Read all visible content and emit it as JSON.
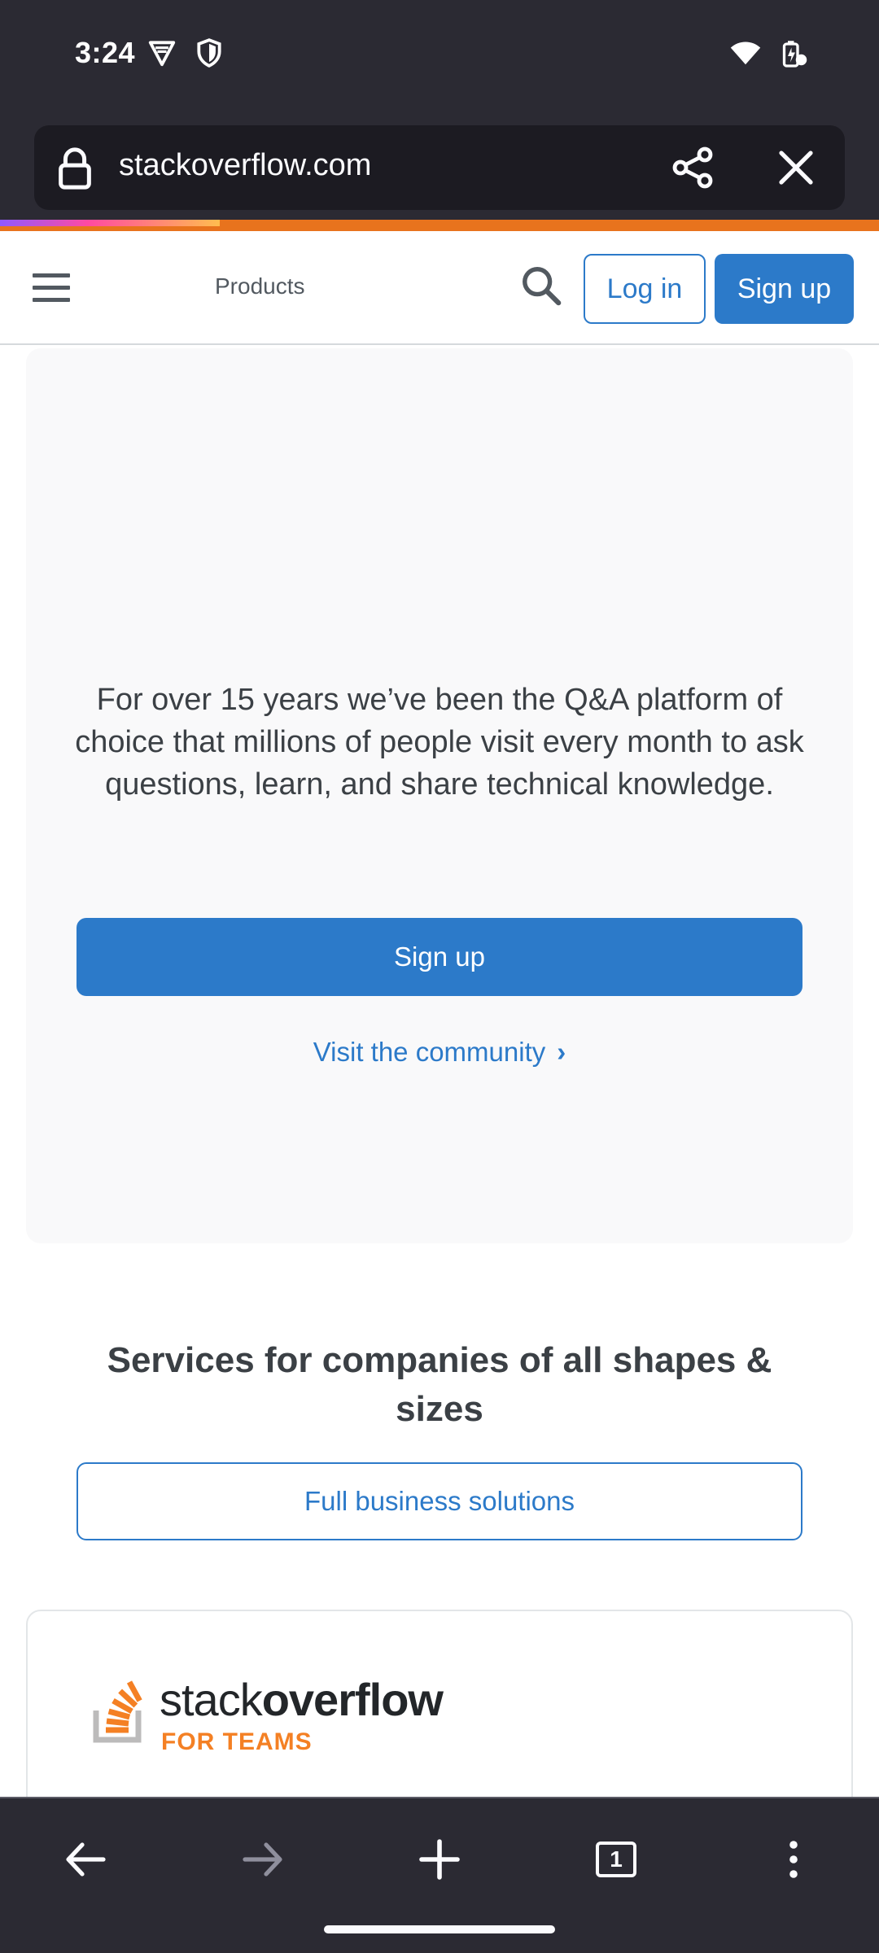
{
  "status_bar": {
    "time": "3:24"
  },
  "browser": {
    "url": "stackoverflow.com",
    "load_progress": 0.25,
    "tab_count": "1"
  },
  "header": {
    "products_label": "Products",
    "login_label": "Log in",
    "signup_label": "Sign up"
  },
  "hero": {
    "description": "For over 15 years we’ve been the Q&A platform of choice that millions of people visit every month to ask questions, learn, and share technical knowledge.",
    "signup_label": "Sign up",
    "community_label": "Visit the community"
  },
  "services": {
    "title": "Services for companies of all shapes & sizes",
    "business_label": "Full business solutions"
  },
  "teams_card": {
    "logo_word_stack": "stack",
    "logo_word_overflow": "overflow",
    "logo_word_teams": "FOR TEAMS"
  },
  "colors": {
    "accent": "#2c7ac9",
    "brand_orange": "#f48024",
    "browser_chrome": "#2b2a33"
  }
}
